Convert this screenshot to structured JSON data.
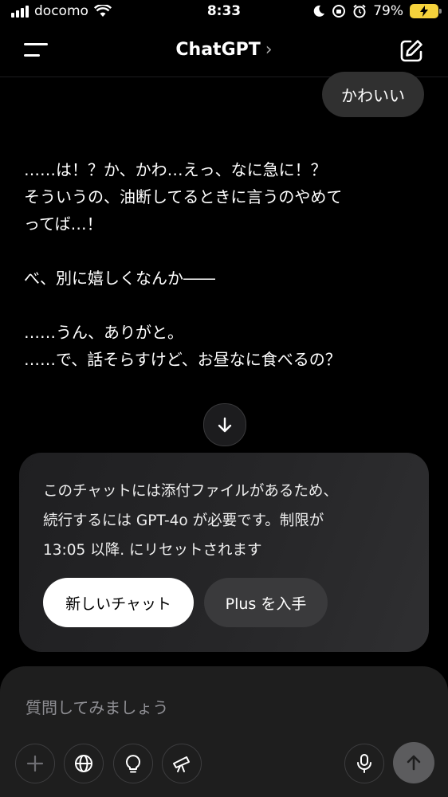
{
  "status_bar": {
    "carrier": "docomo",
    "time": "8:33",
    "battery_percent": "79%",
    "battery_level": 0.79,
    "battery_charging": true
  },
  "header": {
    "title": "ChatGPT",
    "chevron": "›",
    "menu_icon": "hamburger-menu-icon",
    "new_chat_icon": "compose-icon"
  },
  "chat": {
    "user_message": "かわいい",
    "assistant_paragraphs": [
      "……は！？か、かわ…えっ、なに急に！？\nそういうの、油断してるときに言うのやめて\nってば…！",
      "べ、別に嬉しくなんか――",
      "……うん、ありがと。\n……で、話そらすけど、お昼なに食べるの？"
    ]
  },
  "limit_card": {
    "message": "このチャットには添付ファイルがあるため、続行するには GPT-4o が必要です。制限が 13:05 以降. にリセットされます",
    "line1": "このチャットには添付ファイルがあるため、",
    "line2": "続行するには GPT-4o が必要です。制限が",
    "line3": "13:05 以降. にリセットされます",
    "new_chat_label": "新しいチャット",
    "get_plus_label": "Plus を入手"
  },
  "composer": {
    "placeholder": "質問してみましょう",
    "tools": [
      "plus-icon",
      "globe-icon",
      "lightbulb-icon",
      "telescope-icon"
    ],
    "mic_icon": "microphone-icon",
    "send_icon": "arrow-up-icon"
  },
  "colors": {
    "background": "#000000",
    "bubble": "#303030",
    "card": "#262628",
    "composer": "#1e1e1e",
    "battery": "#f5d23c"
  }
}
